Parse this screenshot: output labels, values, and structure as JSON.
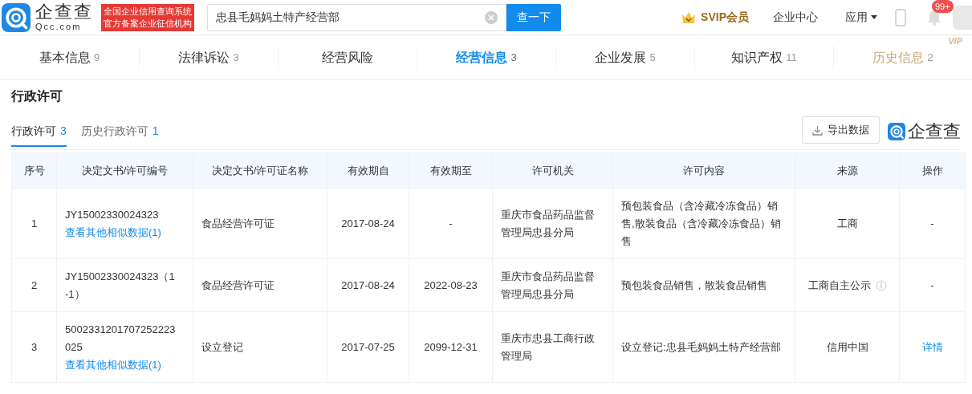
{
  "header": {
    "brand": "企查查",
    "domain": "Qcc.com",
    "slogan": [
      "全国企业信用查询系统",
      "官方备案企业征信机构"
    ],
    "search": {
      "value": "忠县毛妈妈土特产经营部"
    },
    "search_button": "查一下",
    "svip": "SVIP会员",
    "links": [
      "企业中心",
      "应用"
    ],
    "notification_count": "99+"
  },
  "nav_tabs": [
    {
      "label": "基本信息",
      "count": "9",
      "selected": false,
      "muted": false
    },
    {
      "label": "法律诉讼",
      "count": "3",
      "selected": false,
      "muted": false
    },
    {
      "label": "经营风险",
      "selected": false,
      "muted": false
    },
    {
      "label": "经营信息",
      "count": "3",
      "selected": true,
      "muted": false
    },
    {
      "label": "企业发展",
      "count": "5",
      "selected": false,
      "muted": false
    },
    {
      "label": "知识产权",
      "count": "11",
      "selected": false,
      "muted": false
    },
    {
      "label": "历史信息",
      "count": "2",
      "selected": false,
      "muted": true,
      "badge": "VIP"
    }
  ],
  "section": {
    "title": "行政许可",
    "sub_tabs": [
      {
        "label": "行政许可",
        "count": "3",
        "selected": true
      },
      {
        "label": "历史行政许可",
        "count": "1",
        "selected": false
      }
    ],
    "export_button": "导出数据",
    "watermark_brand": "企查查"
  },
  "table": {
    "columns": [
      "序号",
      "决定文书/许可编号",
      "决定文书/许可证名称",
      "有效期自",
      "有效期至",
      "许可机关",
      "许可内容",
      "来源",
      "操作"
    ],
    "rows": [
      {
        "index": "1",
        "number": "JY15002330024323",
        "similar_link": "查看其他相似数据(1)",
        "name": "食品经营许可证",
        "from": "2017-08-24",
        "to": "-",
        "authority": "重庆市食品药品监督管理局忠县分局",
        "content": "预包装食品（含冷藏冷冻食品）销售,散装食品（含冷藏冷冻食品）销售",
        "source": "工商",
        "source_info": false,
        "action": {
          "kind": "text",
          "label": "-"
        }
      },
      {
        "index": "2",
        "number": "JY15002330024323（1-1）",
        "name": "食品经营许可证",
        "from": "2017-08-24",
        "to": "2022-08-23",
        "authority": "重庆市食品药品监督管理局忠县分局",
        "content": "预包装食品销售，散装食品销售",
        "source": "工商自主公示",
        "source_info": true,
        "action": {
          "kind": "text",
          "label": "-"
        }
      },
      {
        "index": "3",
        "number": "5002331201707252223025",
        "similar_link": "查看其他相似数据(1)",
        "name": "设立登记",
        "from": "2017-07-25",
        "to": "2099-12-31",
        "authority": "重庆市忠县工商行政管理局",
        "content": "设立登记:忠县毛妈妈土特产经营部",
        "source": "信用中国",
        "source_info": false,
        "action": {
          "kind": "link",
          "label": "详情"
        }
      }
    ]
  }
}
